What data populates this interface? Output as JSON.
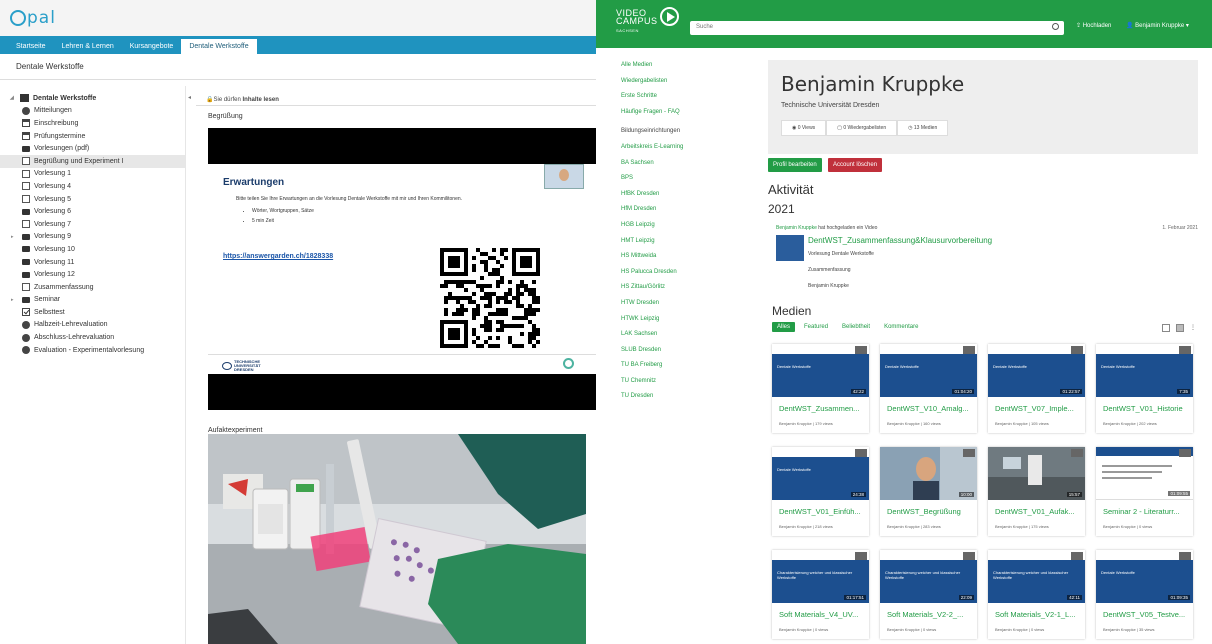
{
  "opal": {
    "logo": "pal",
    "tabs": [
      "Startseite",
      "Lehren & Lernen",
      "Kursangebote",
      "Dentale Werkstoffe"
    ],
    "active_tab_close": "×",
    "page_title": "Dentale Werkstoffe",
    "tree": [
      {
        "label": "Dentale Werkstoffe",
        "icon": "book-icon",
        "root": true
      },
      {
        "label": "Mitteilungen",
        "icon": "info-icon"
      },
      {
        "label": "Einschreibung",
        "icon": "enrollment-icon"
      },
      {
        "label": "Prüfungstermine",
        "icon": "calendar-icon"
      },
      {
        "label": "Vorlesungen (pdf)",
        "icon": "folder-icon"
      },
      {
        "label": "Begrüßung und Experiment I",
        "icon": "document-icon",
        "selected": true
      },
      {
        "label": "Vorlesung 1",
        "icon": "document-icon"
      },
      {
        "label": "Vorlesung 4",
        "icon": "document-icon"
      },
      {
        "label": "Vorlesung 5",
        "icon": "document-icon"
      },
      {
        "label": "Vorlesung 6",
        "icon": "folder-icon"
      },
      {
        "label": "Vorlesung 7",
        "icon": "document-icon"
      },
      {
        "label": "Vorlesung 9",
        "icon": "folder-icon",
        "expandable": true
      },
      {
        "label": "Vorlesung 10",
        "icon": "folder-icon"
      },
      {
        "label": "Vorlesung 11",
        "icon": "folder-icon"
      },
      {
        "label": "Vorlesung 12",
        "icon": "folder-icon"
      },
      {
        "label": "Zusammenfassung",
        "icon": "document-icon"
      },
      {
        "label": "Seminar",
        "icon": "folder-icon",
        "expandable": true
      },
      {
        "label": "Selbsttest",
        "icon": "checkbox-icon"
      },
      {
        "label": "Halbzeit-Lehrevaluation",
        "icon": "evaluation-icon"
      },
      {
        "label": "Abschluss-Lehrevaluation",
        "icon": "evaluation-icon"
      },
      {
        "label": "Evaluation - Experimentalvorlesung",
        "icon": "evaluation-icon"
      }
    ],
    "permission_prefix": "Sie dürfen ",
    "permission_bold": "Inhalte lesen",
    "section1": "Begrüßung",
    "slide_heading": "Erwartungen",
    "slide_text": "Bitte teilen Sie Ihre Erwartungen an die Vorlesung Dentale Werkstoffe mit mir und Ihren Kommilitonen.",
    "slide_bullets": [
      "Wörter, Wortgruppen, Sätze",
      "5 min Zeit"
    ],
    "slide_link": "https://answergarden.ch/1828338",
    "slide_logo_text": "TECHNISCHE UNIVERSITÄT DRESDEN",
    "section2": "Aufaktexperiment"
  },
  "vc": {
    "logo_line1": "VIDEO",
    "logo_line2": "CAMPUS",
    "logo_line3": "SACHSEN",
    "search_placeholder": "Suche",
    "upload": "Hochladen",
    "user": "Benjamin Kruppke ▾",
    "sidebar": [
      {
        "label": "Alle Medien"
      },
      {
        "label": "Wiedergabelisten"
      },
      {
        "label": "Erste Schritte"
      },
      {
        "label": "Häufige Fragen - FAQ"
      },
      {
        "label": "Bildungseinrichtungen",
        "header": true
      },
      {
        "label": "Arbeitskreis E-Learning"
      },
      {
        "label": "BA Sachsen"
      },
      {
        "label": "BPS"
      },
      {
        "label": "HfBK Dresden"
      },
      {
        "label": "HfM Dresden"
      },
      {
        "label": "HGB Leipzig"
      },
      {
        "label": "HMT Leipzig"
      },
      {
        "label": "HS Mittweida"
      },
      {
        "label": "HS Palucca Dresden"
      },
      {
        "label": "HS Zittau/Görlitz"
      },
      {
        "label": "HTW Dresden"
      },
      {
        "label": "HTWK Leipzig"
      },
      {
        "label": "LAK Sachsen"
      },
      {
        "label": "SLUB Dresden"
      },
      {
        "label": "TU BA Freiberg"
      },
      {
        "label": "TU Chemnitz"
      },
      {
        "label": "TU Dresden"
      }
    ],
    "profile_name": "Benjamin Kruppke",
    "profile_uni": "Technische Universität Dresden",
    "stats": [
      "0 Views",
      "0 Wiedergabelisten",
      "13 Medien"
    ],
    "btn_edit": "Profil bearbeiten",
    "btn_delete": "Account löschen",
    "activity_heading": "Aktivität",
    "year": "2021",
    "activity_user": "Benjamin Kruppke",
    "activity_text": " hat hochgeladen ein Video",
    "activity_date": "1. Februar 2021",
    "activity_title": "DentWST_Zusammenfassung&Klausurvorbereitung",
    "activity_sub1": "Vorlesung Dentale Werkstoffe",
    "activity_sub2": "Zusammenfassung",
    "activity_sub3": "Benjamin Kruppke",
    "media_heading": "Medien",
    "filters": [
      "Alles",
      "Featured",
      "Beliebtheit",
      "Kommentare"
    ],
    "cards": [
      {
        "title": "DentWST_Zusammen...",
        "meta": "Benjamin Kruppke | 179 views",
        "dur": "42:22",
        "kind": "slide",
        "slide": "Dentale Werkstoffe"
      },
      {
        "title": "DentWST_V10_Amalg...",
        "meta": "Benjamin Kruppke | 160 views",
        "dur": "01:04:20",
        "kind": "slide",
        "slide": "Dentale Werkstoffe"
      },
      {
        "title": "DentWST_V07_Imple...",
        "meta": "Benjamin Kruppke | 105 views",
        "dur": "01:22:57",
        "kind": "slide",
        "slide": "Dentale Werkstoffe"
      },
      {
        "title": "DentWST_V01_Historie",
        "meta": "Benjamin Kruppke | 202 views",
        "dur": "7:35",
        "kind": "slide",
        "slide": "Dentale Werkstoffe"
      },
      {
        "title": "DentWST_V01_Einfüh...",
        "meta": "Benjamin Kruppke | 218 views",
        "dur": "24:38",
        "kind": "slide",
        "slide": "Dentale Werkstoffe"
      },
      {
        "title": "DentWST_Begrüßung",
        "meta": "Benjamin Kruppke | 283 views",
        "dur": "10:00",
        "kind": "person",
        "slide": ""
      },
      {
        "title": "DentWST_V01_Aufak...",
        "meta": "Benjamin Kruppke | 175 views",
        "dur": "15:57",
        "kind": "lab",
        "slide": ""
      },
      {
        "title": "Seminar 2 - Literaturr...",
        "meta": "Benjamin Kruppke | 0 views",
        "dur": "01:09:55",
        "kind": "light",
        "slide": ""
      },
      {
        "title": "Soft Materials_V4_UV...",
        "meta": "Benjamin Kruppke | 0 views",
        "dur": "01:17:51",
        "kind": "slide",
        "slide": "Charakterisierung weicher und klassischer Werkstoffe"
      },
      {
        "title": "Soft Materials_V2-2_...",
        "meta": "Benjamin Kruppke | 0 views",
        "dur": "22:09",
        "kind": "slide",
        "slide": "Charakterisierung weicher und klassischer Werkstoffe"
      },
      {
        "title": "Soft Materials_V2-1_L...",
        "meta": "Benjamin Kruppke | 0 views",
        "dur": "42:11",
        "kind": "slide",
        "slide": "Charakterisierung weicher und klassischer Werkstoffe"
      },
      {
        "title": "DentWST_V05_Testve...",
        "meta": "Benjamin Kruppke | 35 views",
        "dur": "01:09:35",
        "kind": "slide",
        "slide": "Dentale Werkstoffe"
      }
    ]
  }
}
